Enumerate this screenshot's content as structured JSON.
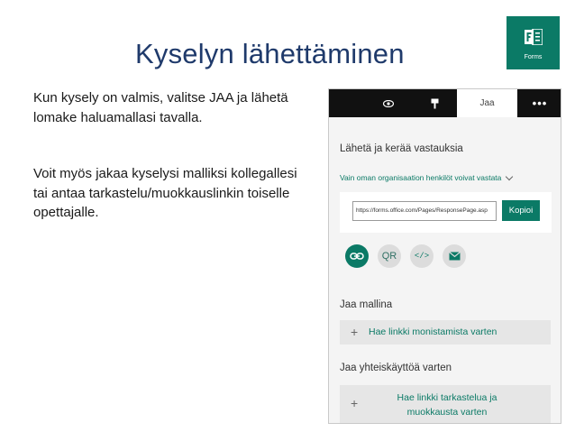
{
  "slide": {
    "title": "Kyselyn lähettäminen",
    "paragraph1": "Kun kysely on valmis, valitse JAA ja lähetä lomake haluamallasi tavalla.",
    "paragraph2": "Voit myös jakaa kyselysi malliksi kollegallesi tai antaa tarkastelu/muokkauslinkin toiselle opettajalle."
  },
  "logo": {
    "label": "Forms",
    "color": "#0b7a66"
  },
  "panel": {
    "topbar": {
      "icons": [
        "eye-icon",
        "theme-icon",
        "more-icon"
      ],
      "active_tab": "Jaa",
      "more": "•••"
    },
    "section_send": "Lähetä ja kerää vastauksia",
    "audience": "Vain oman organisaation henkilöt voivat vastata",
    "url_value": "https://forms.office.com/Pages/ResponsePage.asp",
    "copy_label": "Kopioi",
    "share_options": [
      "link-icon",
      "qr-icon",
      "embed-icon",
      "email-icon"
    ],
    "qr_label": "QR",
    "embed_label": "</>",
    "section_template": "Jaa mallina",
    "template_action": "Hae linkki monistamista varten",
    "section_collab": "Jaa yhteiskäyttöä varten",
    "collab_action": "Hae linkki tarkastelua ja muokkausta varten",
    "plus": "+",
    "accent": "#0b7a66"
  }
}
